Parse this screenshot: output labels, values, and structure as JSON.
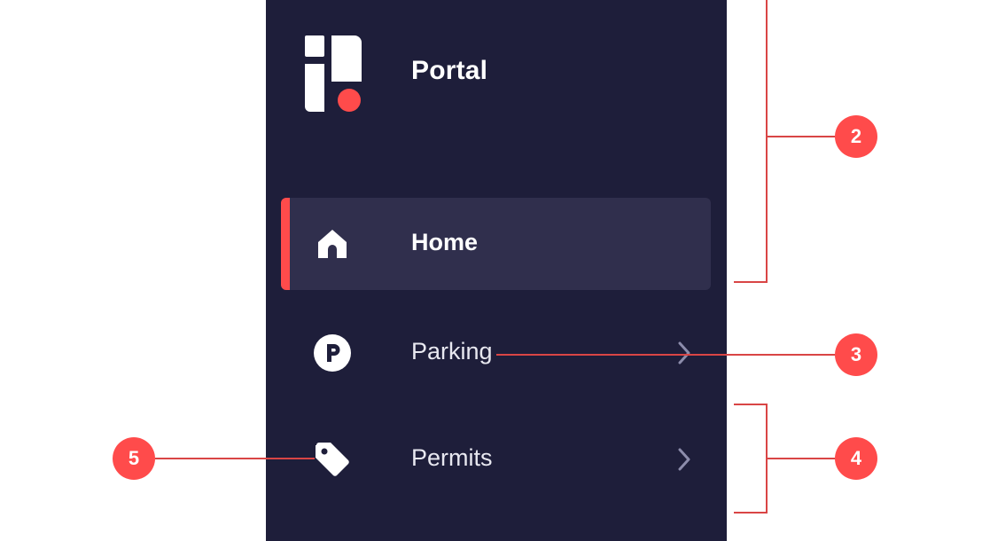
{
  "brand": {
    "title": "Portal"
  },
  "nav": {
    "items": [
      {
        "label": "Home",
        "icon": "home-icon"
      },
      {
        "label": "Parking",
        "icon": "parking-icon"
      },
      {
        "label": "Permits",
        "icon": "tag-icon"
      }
    ]
  },
  "annotations": {
    "callouts": [
      "2",
      "3",
      "4",
      "5"
    ]
  },
  "colors": {
    "sidebar_bg": "#1e1e3a",
    "active_bg": "#302f4d",
    "accent": "#ff4b4b",
    "text": "#ffffff"
  }
}
